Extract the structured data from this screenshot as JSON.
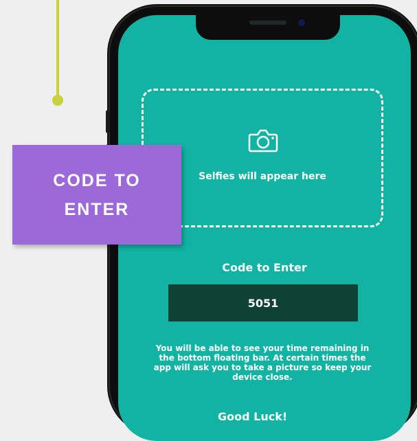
{
  "callout": {
    "label": "CODE TO ENTER"
  },
  "phone": {
    "selfie_placeholder": "Selfies will appear here",
    "code_label": "Code to Enter",
    "code_value": "5051",
    "info_text": "You will be able to see your time remaining in the bottom floating bar. At certain times the app will ask you to take a picture so keep your device close.",
    "next_heading_partial": "Good Luck!"
  },
  "colors": {
    "screen_teal": "#12b3a3",
    "code_box": "#0f4234",
    "callout_purple": "#9b6ad8",
    "connector_yellow": "#c9d23a"
  },
  "icons": {
    "selfie": "camera-icon"
  }
}
